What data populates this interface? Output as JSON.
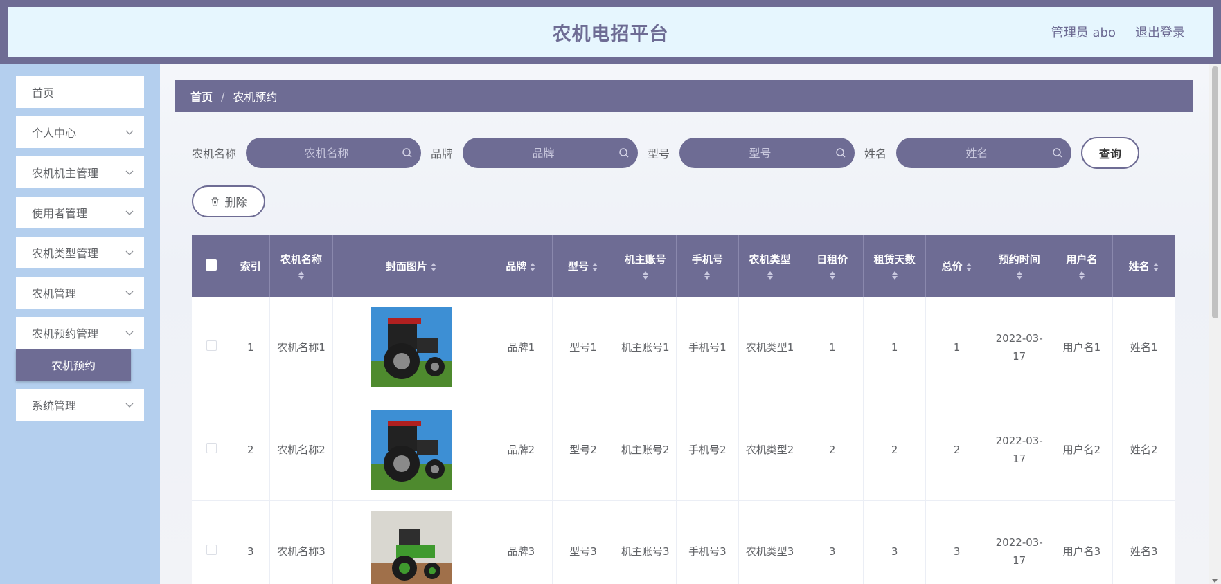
{
  "header": {
    "title": "农机电招平台",
    "user_label": "管理员 abo",
    "logout_label": "退出登录"
  },
  "sidebar": {
    "items": [
      {
        "label": "首页",
        "has_arrow": false
      },
      {
        "label": "个人中心",
        "has_arrow": true
      },
      {
        "label": "农机机主管理",
        "has_arrow": true
      },
      {
        "label": "使用者管理",
        "has_arrow": true
      },
      {
        "label": "农机类型管理",
        "has_arrow": true
      },
      {
        "label": "农机管理",
        "has_arrow": true
      },
      {
        "label": "农机预约管理",
        "has_arrow": true
      },
      {
        "label": "系统管理",
        "has_arrow": true
      }
    ],
    "active_sub": "农机预约"
  },
  "breadcrumb": {
    "home": "首页",
    "separator": "/",
    "current": "农机预约"
  },
  "search": {
    "fields": [
      {
        "label": "农机名称",
        "placeholder": "农机名称"
      },
      {
        "label": "品牌",
        "placeholder": "品牌"
      },
      {
        "label": "型号",
        "placeholder": "型号"
      },
      {
        "label": "姓名",
        "placeholder": "姓名"
      }
    ],
    "query_label": "查询",
    "delete_label": "删除"
  },
  "table": {
    "columns": [
      "索引",
      "农机名称",
      "封面图片",
      "品牌",
      "型号",
      "机主账号",
      "手机号",
      "农机类型",
      "日租价",
      "租赁天数",
      "总价",
      "预约时间",
      "用户名",
      "姓名"
    ],
    "rows": [
      {
        "index": "1",
        "name": "农机名称1",
        "brand": "品牌1",
        "model": "型号1",
        "owner": "机主账号1",
        "phone": "手机号1",
        "type": "农机类型1",
        "daily": "1",
        "days": "1",
        "total": "1",
        "time": "2022-03-17",
        "user": "用户名1",
        "realname": "姓名1"
      },
      {
        "index": "2",
        "name": "农机名称2",
        "brand": "品牌2",
        "model": "型号2",
        "owner": "机主账号2",
        "phone": "手机号2",
        "type": "农机类型2",
        "daily": "2",
        "days": "2",
        "total": "2",
        "time": "2022-03-17",
        "user": "用户名2",
        "realname": "姓名2"
      },
      {
        "index": "3",
        "name": "农机名称3",
        "brand": "品牌3",
        "model": "型号3",
        "owner": "机主账号3",
        "phone": "手机号3",
        "type": "农机类型3",
        "daily": "3",
        "days": "3",
        "total": "3",
        "time": "2022-03-17",
        "user": "用户名3",
        "realname": "姓名3"
      }
    ]
  },
  "colors": {
    "accent": "#6e6c94",
    "header_bg": "#e6f6fe",
    "sidebar_bg": "#b4cfee"
  }
}
